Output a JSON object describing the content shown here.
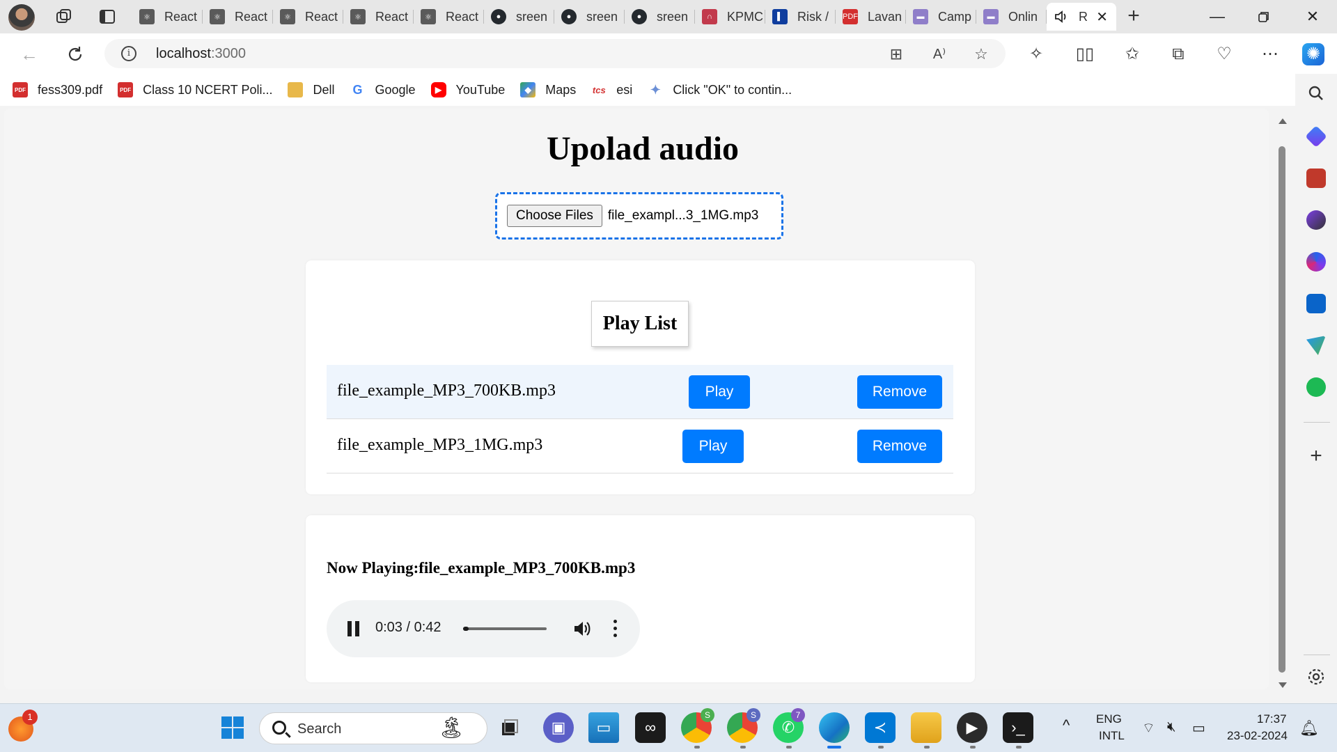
{
  "browser": {
    "tabs": [
      {
        "label": "React",
        "icon": "react-icon",
        "color": "#5a5a5a"
      },
      {
        "label": "React",
        "icon": "react-icon",
        "color": "#5a5a5a"
      },
      {
        "label": "React",
        "icon": "react-icon",
        "color": "#5a5a5a"
      },
      {
        "label": "React",
        "icon": "react-icon",
        "color": "#5a5a5a"
      },
      {
        "label": "React",
        "icon": "react-icon",
        "color": "#5a5a5a"
      },
      {
        "label": "sreen",
        "icon": "github-icon",
        "color": "#24292e"
      },
      {
        "label": "sreen",
        "icon": "github-icon",
        "color": "#24292e"
      },
      {
        "label": "sreen",
        "icon": "github-icon",
        "color": "#24292e"
      },
      {
        "label": "KPMC",
        "icon": "kpmg-icon",
        "color": "#c23a4c"
      },
      {
        "label": "Risk /",
        "icon": "risk-icon",
        "color": "#0f3d9e"
      },
      {
        "label": "Lavan",
        "icon": "pdf-icon",
        "color": "#d32f2f"
      },
      {
        "label": "Camp",
        "icon": "page-icon",
        "color": "#8f7ec9"
      },
      {
        "label": "Onlin",
        "icon": "page-icon",
        "color": "#8f7ec9"
      }
    ],
    "active_tab": {
      "label": "R",
      "icon": "speaker-icon"
    },
    "address": {
      "host": "localhost",
      "port": ":3000"
    },
    "bookmarks": [
      {
        "label": "fess309.pdf",
        "icon": "pdf-icon",
        "color": "#d32f2f",
        "glyph": "PDF"
      },
      {
        "label": "Class 10 NCERT Poli...",
        "icon": "pdf-icon",
        "color": "#d32f2f",
        "glyph": "PDF"
      },
      {
        "label": "Dell",
        "icon": "folder-icon",
        "color": "#e8b84a",
        "glyph": ""
      },
      {
        "label": "Google",
        "icon": "google-icon",
        "color": "#ffffff",
        "glyph": "G"
      },
      {
        "label": "YouTube",
        "icon": "youtube-icon",
        "color": "#ff0000",
        "glyph": "▶"
      },
      {
        "label": "Maps",
        "icon": "maps-icon",
        "color": "#34a853",
        "glyph": "◆"
      },
      {
        "label": "esi",
        "icon": "tcs-icon",
        "color": "#ffffff",
        "glyph": "tcs"
      },
      {
        "label": "Click \"OK\" to contin...",
        "icon": "extension-icon",
        "color": "#6b8fd6",
        "glyph": "✦"
      }
    ]
  },
  "app": {
    "title": "Upolad audio",
    "upload": {
      "button_label": "Choose Files",
      "file_name": "file_exampl...3_1MG.mp3"
    },
    "playlist": {
      "heading": "Play List",
      "items": [
        {
          "name": "file_example_MP3_700KB.mp3",
          "play_label": "Play",
          "remove_label": "Remove"
        },
        {
          "name": "file_example_MP3_1MG.mp3",
          "play_label": "Play",
          "remove_label": "Remove"
        }
      ]
    },
    "player": {
      "now_playing_label": "Now Playing:file_example_MP3_700KB.mp3",
      "time": "0:03 / 0:42",
      "progress_fraction": 0.07
    }
  },
  "taskbar": {
    "search_label": "Search",
    "notification_badge": "1",
    "chrome_badge_1": "S",
    "chrome_badge_2": "S",
    "whatsapp_badge": "7",
    "language": "ENG",
    "layout": "INTL",
    "time": "17:37",
    "date": "23-02-2024"
  },
  "colors": {
    "accent": "#007bff",
    "dashed_border": "#1a73e8",
    "row_highlight": "#eef5fd"
  }
}
